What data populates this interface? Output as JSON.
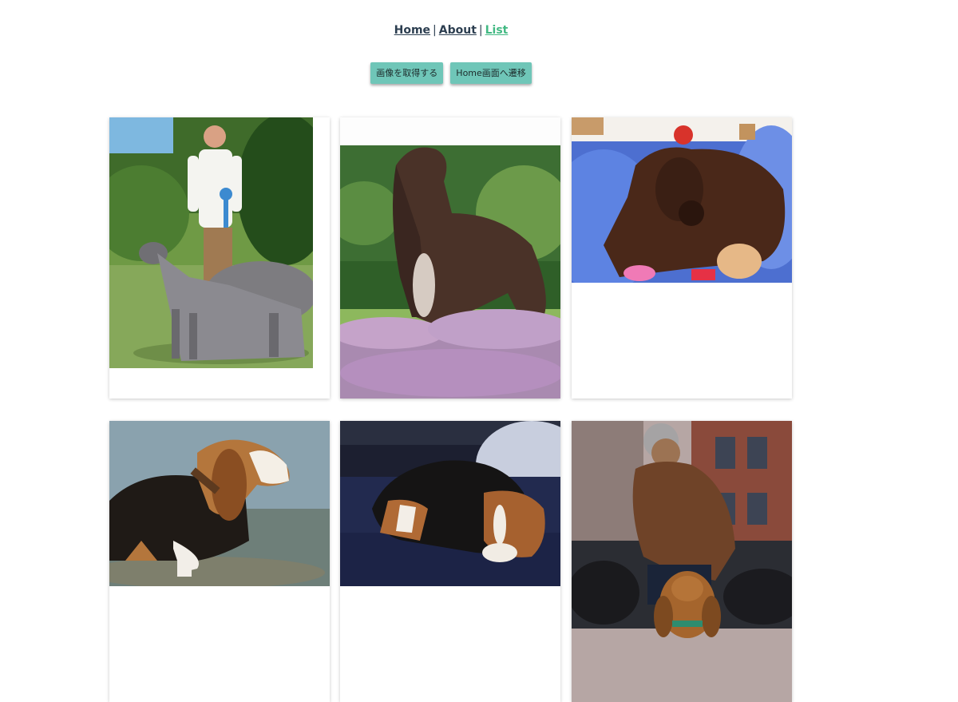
{
  "nav": {
    "home": "Home",
    "separator": "|",
    "about": "About",
    "list": "List"
  },
  "actions": {
    "fetch_images": "画像を取得する",
    "go_home": "Home画面へ遷移"
  },
  "cards": [
    {
      "subject": "afghan-hound-with-handler"
    },
    {
      "subject": "afghan-hound-in-garden"
    },
    {
      "subject": "afghan-hound-on-blanket"
    },
    {
      "subject": "basset-hound-in-water"
    },
    {
      "subject": "basset-hound-on-couch"
    },
    {
      "subject": "bloodhound-with-man"
    }
  ]
}
